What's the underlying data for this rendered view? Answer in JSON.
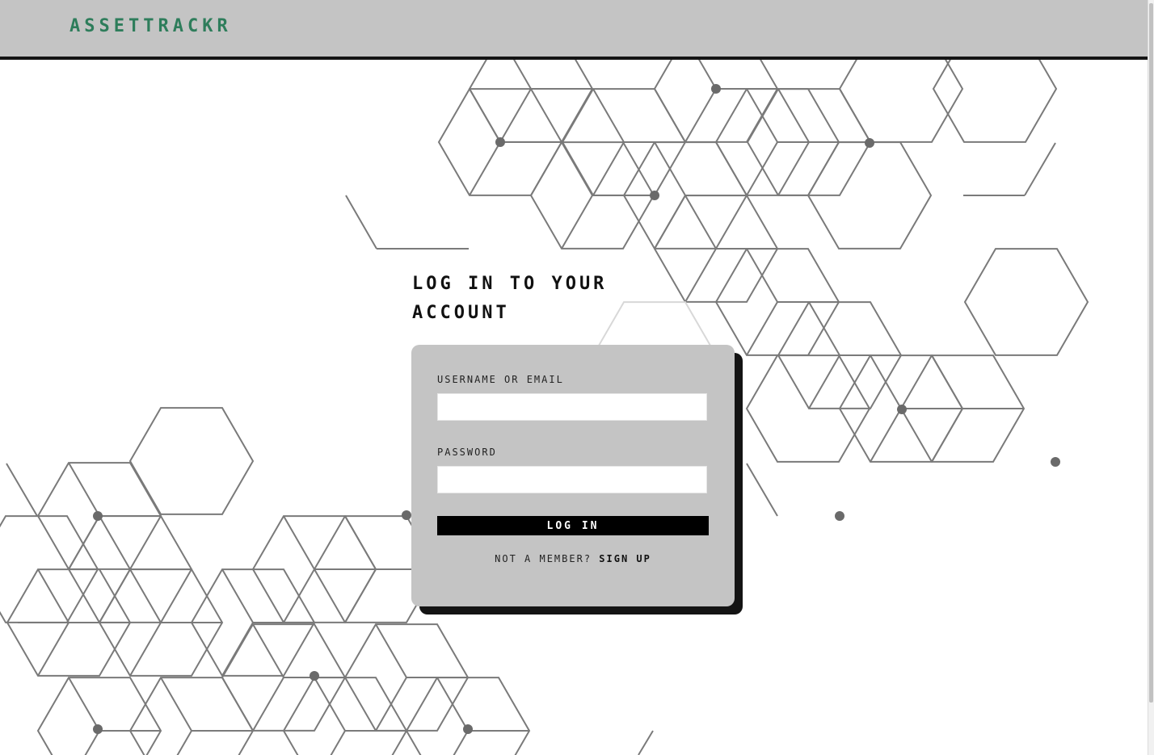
{
  "navbar": {
    "brand": "ASSETTRACKR",
    "brand_color": "#2e7d5b",
    "background": "#c4c4c4"
  },
  "login": {
    "heading": "LOG IN TO YOUR ACCOUNT",
    "username_label": "USERNAME OR EMAIL",
    "username_value": "",
    "password_label": "PASSWORD",
    "password_value": "",
    "submit_label": "LOG IN",
    "not_member_text": "NOT A MEMBER?",
    "signup_label": "SIGN UP"
  },
  "background": {
    "pattern": "hexagonal-cube-lines",
    "line_color": "#7a7a7a"
  }
}
